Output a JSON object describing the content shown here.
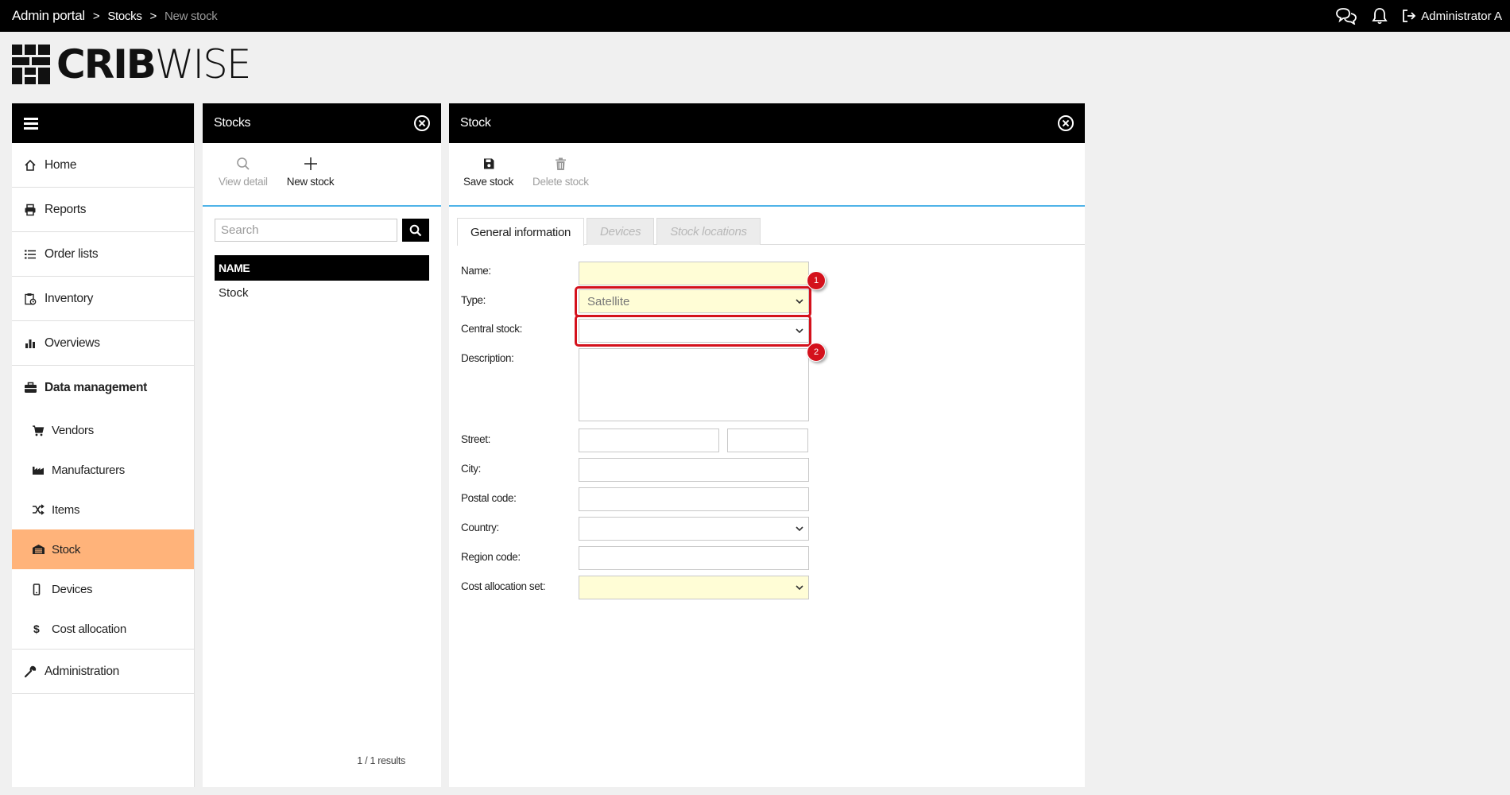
{
  "topbar": {
    "breadcrumb": [
      "Admin portal",
      "Stocks",
      "New stock"
    ],
    "separator": ">",
    "user": "Administrator A",
    "icons": [
      "chat-icon",
      "bell-icon",
      "logout-icon"
    ]
  },
  "logo": {
    "bold": "CRIB",
    "light": "WISE"
  },
  "nav": {
    "items": [
      {
        "label": "Home",
        "icon": "home-icon"
      },
      {
        "label": "Reports",
        "icon": "printer-icon"
      },
      {
        "label": "Order lists",
        "icon": "list-icon"
      },
      {
        "label": "Inventory",
        "icon": "clipboard-icon"
      },
      {
        "label": "Overviews",
        "icon": "bar-chart-icon"
      },
      {
        "label": "Data management",
        "icon": "briefcase-icon"
      }
    ],
    "sub_items": [
      {
        "label": "Vendors",
        "icon": "cart-icon"
      },
      {
        "label": "Manufacturers",
        "icon": "factory-icon"
      },
      {
        "label": "Items",
        "icon": "shuffle-icon"
      },
      {
        "label": "Stock",
        "icon": "warehouse-icon"
      },
      {
        "label": "Devices",
        "icon": "mobile-icon"
      },
      {
        "label": "Cost allocation",
        "icon": "dollar-icon"
      }
    ],
    "administration": {
      "label": "Administration",
      "icon": "wrench-icon"
    },
    "active_color": "#ffb37a"
  },
  "stocks_panel": {
    "title": "Stocks",
    "view_detail": "View detail",
    "new_stock": "New stock",
    "search_placeholder": "Search",
    "column_header": "NAME",
    "rows": [
      "Stock"
    ],
    "results": "1 / 1 results"
  },
  "detail_panel": {
    "title": "Stock",
    "save": "Save stock",
    "delete": "Delete stock",
    "tabs": [
      "General information",
      "Devices",
      "Stock locations"
    ],
    "form": {
      "name_label": "Name:",
      "type_label": "Type:",
      "type_value": "Satellite",
      "central_label": "Central stock:",
      "description_label": "Description:",
      "street_label": "Street:",
      "city_label": "City:",
      "postal_label": "Postal code:",
      "country_label": "Country:",
      "region_label": "Region code:",
      "cost_label": "Cost allocation set:"
    }
  },
  "annotations": {
    "badge1": "1",
    "badge2": "2",
    "color": "#d4111c"
  },
  "colors": {
    "accent_line": "#4fb3e8",
    "required_field": "#fffdd6"
  }
}
